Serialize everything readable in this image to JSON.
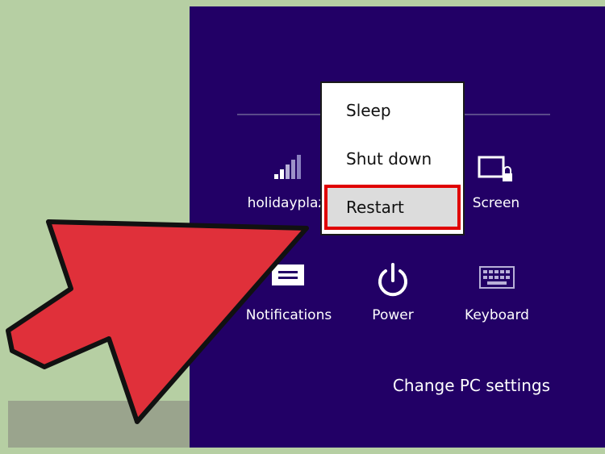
{
  "charms_panel": {
    "background": "#220066",
    "tiles": {
      "network_label": "holidayplaz",
      "screen_label": "Screen",
      "notifications_label": "Notifications",
      "power_label": "Power",
      "keyboard_label": "Keyboard"
    },
    "change_pc_settings": "Change PC settings"
  },
  "power_menu": {
    "items": [
      "Sleep",
      "Shut down",
      "Restart"
    ],
    "selected": "Restart",
    "highlight_color": "#e00000"
  },
  "pointer_arrow": {
    "color": "#e0303a",
    "outline": "#111111"
  },
  "icons": [
    "signal-bars-icon",
    "screen-lock-icon",
    "notifications-icon",
    "power-icon",
    "keyboard-icon"
  ]
}
